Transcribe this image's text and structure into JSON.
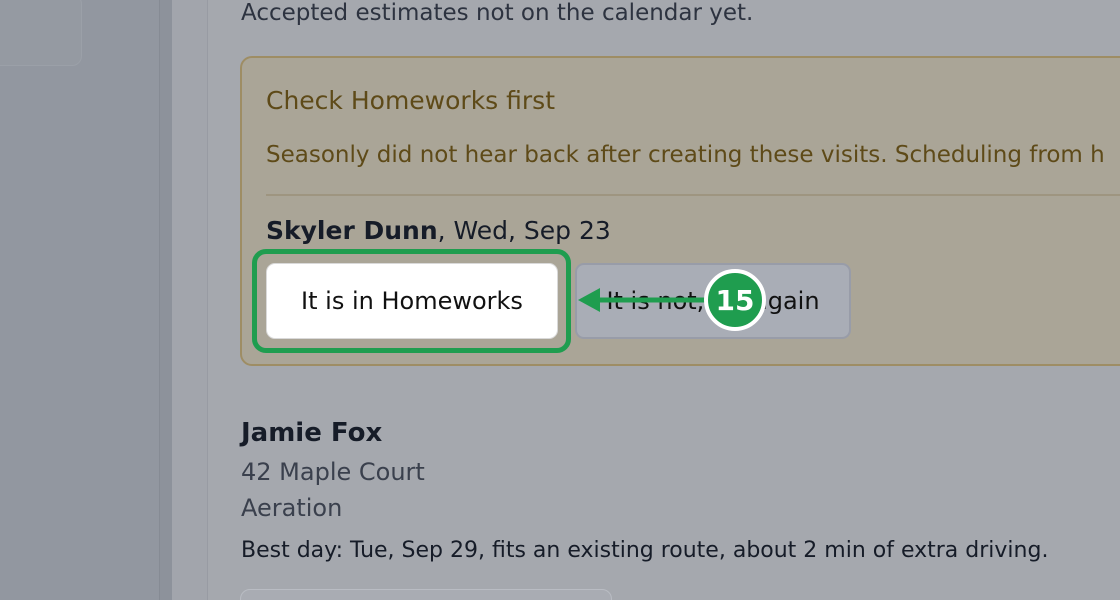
{
  "subtitle": "Accepted estimates not on the calendar yet.",
  "warning": {
    "title": "Check Homeworks first",
    "text": "Seasonly did not hear back after creating these visits. Scheduling from h"
  },
  "pending_visit": {
    "customer": "Skyler Dunn",
    "date": ", Wed, Sep 23"
  },
  "buttons": {
    "confirm_label": "It is in Homeworks",
    "deny_label": "It is not, try again"
  },
  "annotation": {
    "step_number": "15",
    "color": "#1f9d4f"
  },
  "estimate": {
    "name": "Jamie Fox",
    "address": "42 Maple Court",
    "service": "Aeration",
    "best_day": "Best day: Tue, Sep 29, fits an existing route, about 2 min of extra driving."
  }
}
